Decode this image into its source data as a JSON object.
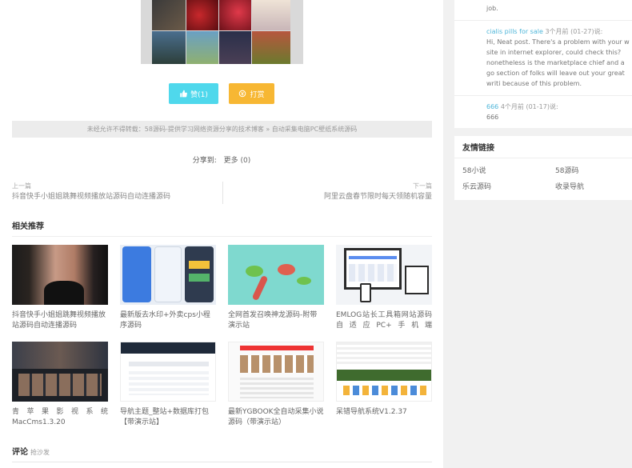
{
  "post": {
    "like_label": "赞(1)",
    "tip_label": "打赏",
    "copyright": "未经允许不得转载：58源码-提供学习网络资源分享的技术博客 » 自动采集电脑PC壁纸系统源码",
    "share_label": "分享到:",
    "share_more": "更多 (0)",
    "prev_label": "上一篇",
    "prev_title": "抖音快手小姐姐跳舞视频播放站源码自动连播源码",
    "next_label": "下一篇",
    "next_title": "阿里云盘春节限时每天领随机容量"
  },
  "related": {
    "title": "相关推荐",
    "items": [
      {
        "title": "抖音快手小姐姐跳舞视频播放站源码自动连播源码"
      },
      {
        "title": "最新版去水印+外卖cps小程序源码"
      },
      {
        "title": "全网首发召唤神龙源码-附带演示站"
      },
      {
        "title": "EMLOG站长工具箱网站源码自适应PC+手机端"
      },
      {
        "title": "青苹果影视系统MacCms1.3.20"
      },
      {
        "title": "导航主题_整站+数据库打包【带演示站】"
      },
      {
        "title": "最新YGBOOK全自动采集小说源码（带演示站）"
      },
      {
        "title": "呆错导航系统V1.2.37"
      }
    ]
  },
  "comments_section": {
    "title": "评论",
    "subtitle": "抢沙发"
  },
  "sidebar": {
    "comments": [
      {
        "text_tail": "job."
      },
      {
        "name": "cialis pills for sale",
        "meta": "3个月前 (01-27)说:",
        "body": "Hi, Neat post. There's a problem with your w site in internet explorer, could check this? nonetheless is the marketplace chief and a go section of folks will leave out your great writi because of this problem."
      },
      {
        "name": "666",
        "meta": "4个月前 (01-17)说:",
        "body": "666"
      }
    ],
    "links_title": "友情链接",
    "links": [
      "58小说",
      "58源码",
      "乐云源码",
      "收录导航"
    ]
  },
  "colors": {
    "like": "#4fd8ec",
    "tip": "#f7b733",
    "comment_name": "#4fb6d9"
  }
}
